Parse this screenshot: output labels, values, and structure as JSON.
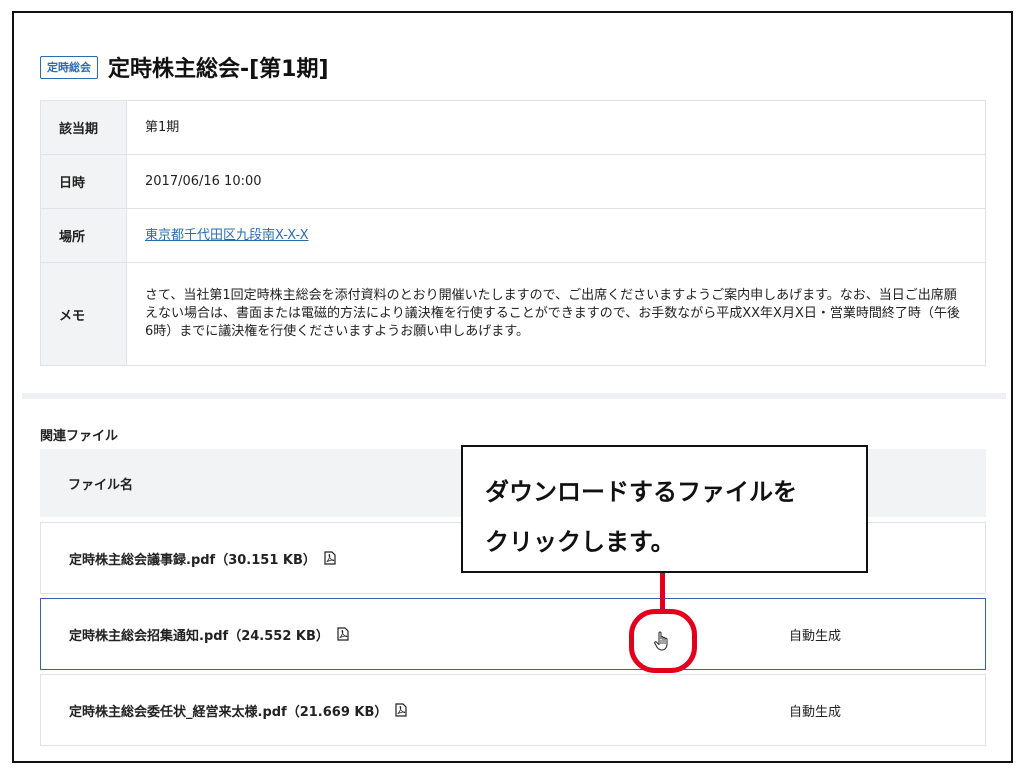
{
  "header": {
    "badge": "定時総会",
    "title": "定時株主総会-[第1期]"
  },
  "info": {
    "rows": [
      {
        "label": "該当期",
        "value": "第1期"
      },
      {
        "label": "日時",
        "value": "2017/06/16 10:00"
      },
      {
        "label": "場所",
        "value": "東京都千代田区九段南X-X-X"
      },
      {
        "label": "メモ",
        "value": "さて、当社第1回定時株主総会を添付資料のとおり開催いたしますので、ご出席くださいますようご案内申しあげます。なお、当日ご出席願えない場合は、書面または電磁的方法により議決権を行使することができますので、お手数ながら平成XX年X月X日・営業時間終了時（午後6時）までに議決権を行使くださいますようお願い申しあげます。"
      }
    ]
  },
  "files": {
    "section_label": "関連ファイル",
    "column_header": "ファイル名",
    "rows": [
      {
        "name": "定時株主総会議事録.pdf（30.151 KB）",
        "kind": ""
      },
      {
        "name": "定時株主総会招集通知.pdf（24.552 KB）",
        "kind": "自動生成"
      },
      {
        "name": "定時株主総会委任状_経営来太様.pdf（21.669 KB）",
        "kind": "自動生成"
      }
    ]
  },
  "callout": {
    "line1": "ダウンロードするファイルを",
    "line2": "クリックします。"
  },
  "colors": {
    "accent": "#2b6cb0",
    "highlight": "#e3001b",
    "table_header_bg": "#f2f3f5"
  },
  "icons": [
    "pdf-file-icon",
    "hand-pointer-icon"
  ]
}
